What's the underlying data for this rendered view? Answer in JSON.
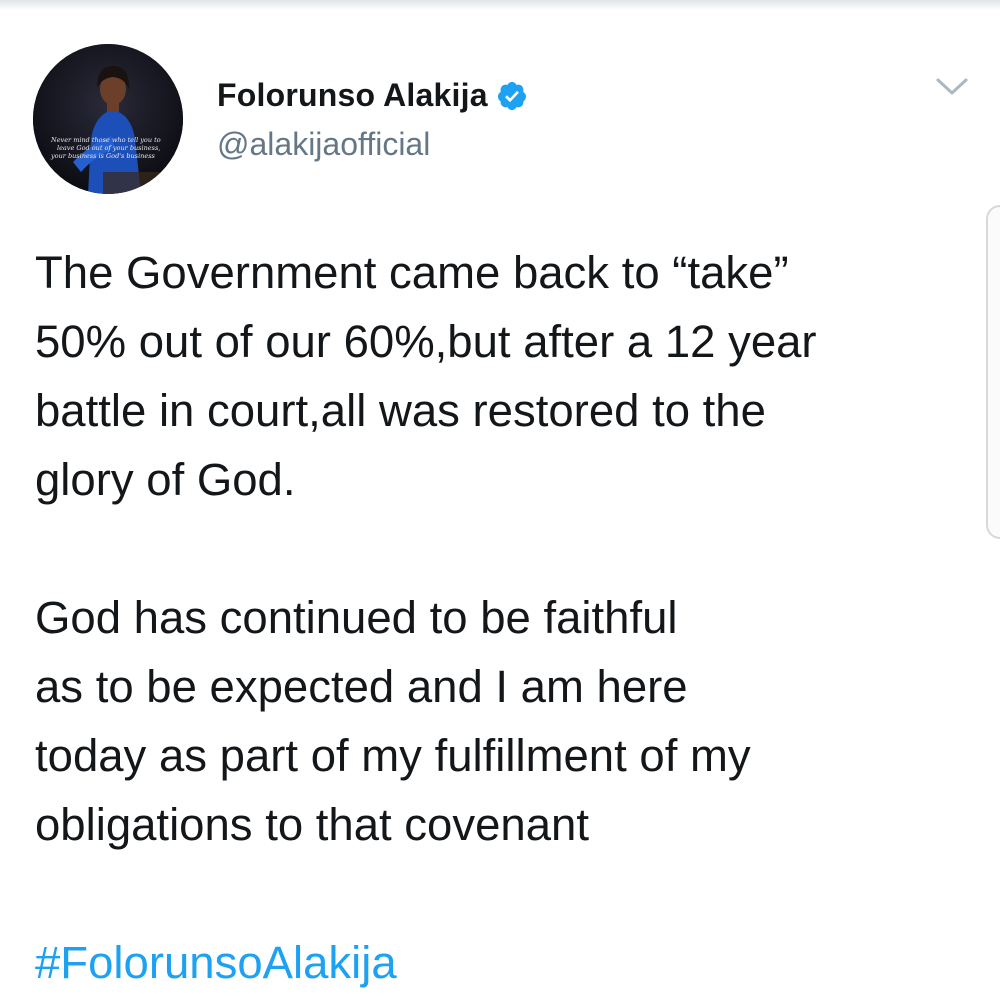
{
  "user": {
    "display_name": "Folorunso Alakija",
    "handle": "@alakijaofficial",
    "verified": true,
    "avatar_quote_lines": [
      "Never mind those who tell you to",
      "leave God out of your business,",
      "your business is God's business"
    ]
  },
  "tweet": {
    "paragraphs": [
      [
        "The Government came back to “take”",
        "50% out of our 60%,but after a 12 year",
        "battle in court,all was restored to the",
        "glory of God."
      ],
      [
        "God has continued to be faithful",
        "as to be expected and I am here",
        "today as part of my fulfillment of my",
        "obligations to that covenant"
      ]
    ],
    "hashtag": "#FolorunsoAlakija"
  },
  "icons": {
    "verified": "verified-badge-icon",
    "menu": "chevron-down-icon"
  },
  "colors": {
    "link": "#1da1f2",
    "verified": "#1da1f2",
    "text": "#14171a",
    "secondary": "#657786"
  }
}
